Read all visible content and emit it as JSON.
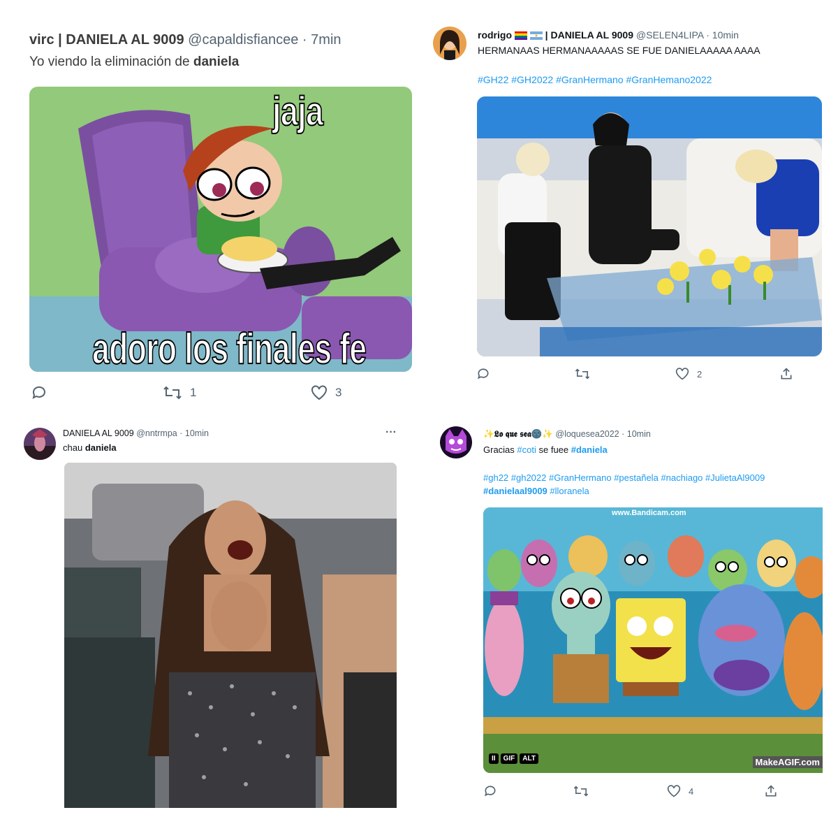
{
  "colors": {
    "link": "#1d9bf0",
    "muted": "#536471",
    "text": "#0f1419",
    "panel_border": "#eff3f4"
  },
  "tweets": [
    {
      "author": "virc | DANIELA AL 9009",
      "handle": "@capaldisfiancee",
      "sep": "·",
      "time": "7min",
      "text_prefix": "Yo viendo la eliminación de ",
      "text_bold": "daniela",
      "media": {
        "caption_top": "jaja",
        "caption_bottom": "adoro los finales fe"
      },
      "replies": "",
      "retweets": "1",
      "likes": "3"
    },
    {
      "author": "rodrigo",
      "author_rest": "| DANIELA AL 9009",
      "handle": "@SELEN4LIPA",
      "sep": "·",
      "time": "10min",
      "text": "HERMANAAS HERMANAAAAAS SE FUE DANIELAAAAA AAAA",
      "hashtags": "#GH22 #GH2022 #GranHermano #GranHemano2022",
      "retweets": "",
      "likes": "2"
    },
    {
      "author": "DANIELA AL 9009",
      "handle": "@nntrmpa",
      "sep": "·",
      "time": "10min",
      "more": "···",
      "text_prefix": "chau ",
      "text_bold": "daniela"
    },
    {
      "author": "✨𝕷𝖔 𝖖𝖚𝖊 𝖘𝖊𝖆🌚✨",
      "handle": "@loquesea2022",
      "sep": "·",
      "time": "10min",
      "text_prefix": "Gracias ",
      "text_tag1": "#coti",
      "text_mid": " se fuee ",
      "text_tag2": "#daniela",
      "hashtags_line1": "#gh22 #gh2022 #GranHermano #pestañela #nachiago #JulietaAl9009",
      "hashtags_line2_bold": "#danielaal9009",
      "hashtags_line2_rest": " #lloranela",
      "media": {
        "watermark_top": "www.Bandicam.com",
        "badge_pause": "II",
        "badge_gif": "GIF",
        "badge_alt": "ALT",
        "watermark_bottom": "MakeAGIF.com"
      },
      "retweets": "",
      "likes": "4"
    }
  ]
}
